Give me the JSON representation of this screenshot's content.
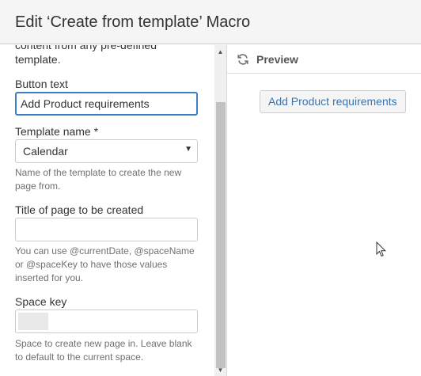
{
  "dialog": {
    "title": "Edit ‘Create from template’ Macro"
  },
  "form": {
    "cut_description": "content from any pre-defined template.",
    "button_text": {
      "label": "Button text",
      "value": "Add Product requirements"
    },
    "template_name": {
      "label": "Template name *",
      "selected": "Calendar",
      "help": "Name of the template to create the new page from."
    },
    "page_title": {
      "label": "Title of page to be created",
      "value": "",
      "help": "You can use @currentDate, @spaceName or @spaceKey to have those values inserted for you."
    },
    "space_key": {
      "label": "Space key",
      "help": "Space to create new page in. Leave blank to default to the current space."
    }
  },
  "preview": {
    "label": "Preview",
    "button_label": "Add Product requirements",
    "icon": "refresh-icon"
  },
  "colors": {
    "accent": "#3b7fc4",
    "link": "#3b73af",
    "help_text": "#707070"
  }
}
